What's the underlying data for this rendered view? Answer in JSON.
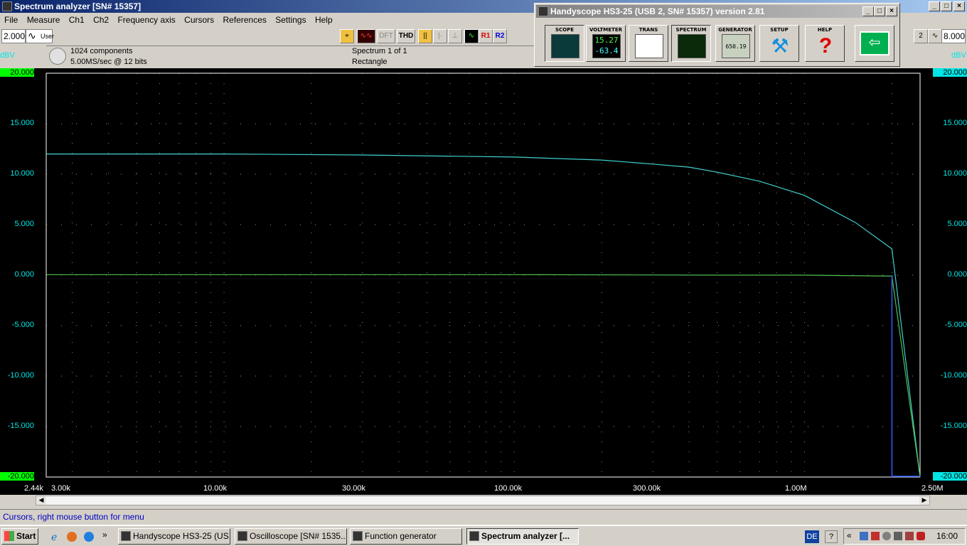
{
  "window": {
    "title": "Spectrum analyzer  [SN# 15357]",
    "controls": [
      "_",
      "□",
      "×"
    ]
  },
  "menu": [
    "File",
    "Measure",
    "Ch1",
    "Ch2",
    "Frequency axis",
    "Cursors",
    "References",
    "Settings",
    "Help"
  ],
  "toolbar": {
    "left_value": "2.000",
    "left_mode": "User",
    "right_value": "8.000",
    "buttons": [
      "DFT",
      "THD",
      "R1",
      "R2"
    ]
  },
  "info": {
    "components": "1024 components",
    "rate": "5.00MS/sec @ 12 bits",
    "spectrum": "Spectrum 1 of 1",
    "window": "Rectangle"
  },
  "handyscope": {
    "title": "Handyscope HS3-25 (USB 2, SN# 15357) version 2.81",
    "buttons": [
      "SCOPE",
      "VOLTMETER",
      "TRANS",
      "SPECTRUM",
      "GENERATOR",
      "SETUP",
      "HELP"
    ],
    "voltmeter_line1": "15.27",
    "voltmeter_line2": "-63.4",
    "generator_readout": "650.19"
  },
  "axis": {
    "unit_left": "dBV",
    "unit_right": "dBV",
    "y_ticks": [
      "20.000",
      "15.000",
      "10.000",
      "5.000",
      "0.000",
      "-5.000",
      "-10.000",
      "-15.000",
      "-20.000"
    ],
    "x_start": "2.44k",
    "x_ticks": [
      "3.00k",
      "10.00k",
      "30.00k",
      "100.00k",
      "300.00k",
      "1.00M"
    ],
    "x_end": "2.50M"
  },
  "chart_data": {
    "type": "line",
    "xlabel": "",
    "ylabel": "dBV",
    "xscale": "log",
    "xlim": [
      2440,
      2500000
    ],
    "ylim": [
      -20,
      20
    ],
    "grid": true,
    "series": [
      {
        "color": "#40d0d0",
        "x": [
          2440,
          3000,
          10000,
          30000,
          100000,
          200000,
          300000,
          400000,
          500000,
          700000,
          1000000,
          1500000,
          2000000,
          2500000
        ],
        "y": [
          12.0,
          12.0,
          12.0,
          11.9,
          11.7,
          11.4,
          11.0,
          10.7,
          10.2,
          9.3,
          7.9,
          5.2,
          2.6,
          -20.0
        ]
      },
      {
        "color": "#50c050",
        "x": [
          2440,
          100000,
          500000,
          1000000,
          2000000,
          2500000
        ],
        "y": [
          0.05,
          0.05,
          0.0,
          0.0,
          -0.1,
          -20.0
        ]
      }
    ]
  },
  "status": "Cursors, right mouse button for menu",
  "taskbar": {
    "start": "Start",
    "tasks": [
      "Handyscope HS3-25 (US...",
      "Oscilloscope  [SN# 1535...",
      "Function generator",
      "Spectrum analyzer  [..."
    ],
    "lang": "DE",
    "time": "16:00"
  }
}
